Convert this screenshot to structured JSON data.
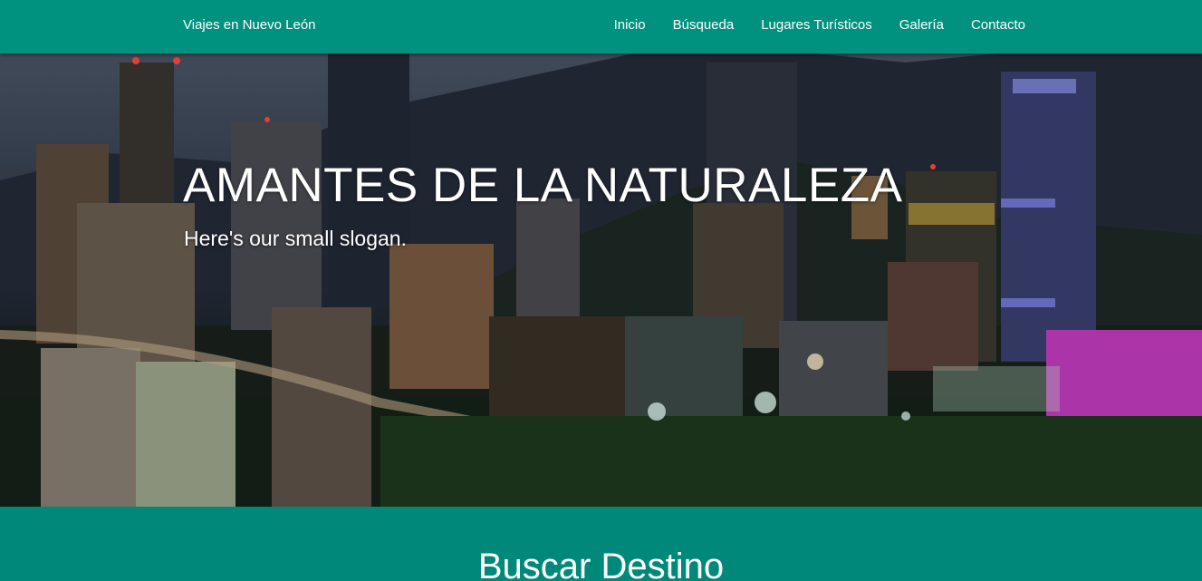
{
  "navbar": {
    "brand": "Viajes en Nuevo León",
    "links": [
      "Inicio",
      "Búsqueda",
      "Lugares Turísticos",
      "Galería",
      "Contacto"
    ]
  },
  "hero": {
    "title": "AMANTES DE LA NATURALEZA",
    "slogan": "Here's our small slogan.",
    "image": "city-skyline-night"
  },
  "search_section": {
    "heading": "Buscar Destino"
  },
  "colors": {
    "primary": "#00917f",
    "section_bg": "#00897b",
    "text": "#ffffff"
  }
}
